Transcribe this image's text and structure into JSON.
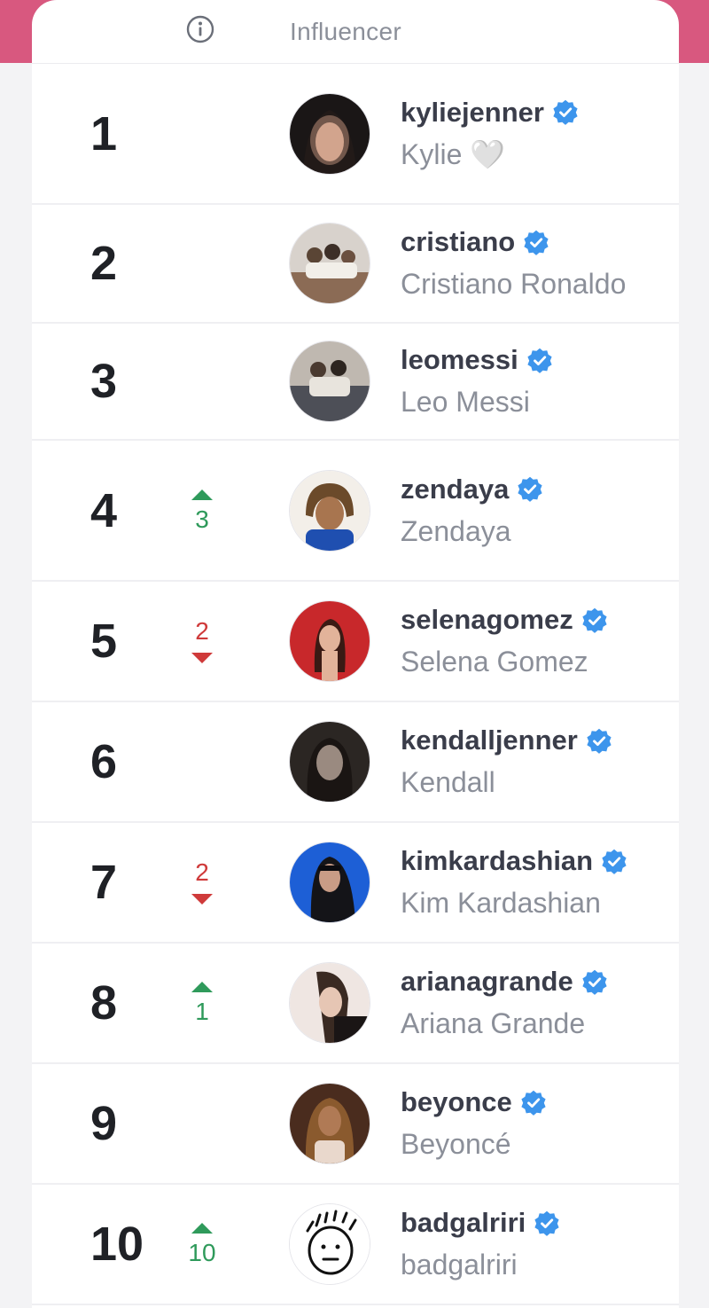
{
  "header": {
    "info_icon": "info-circle-icon",
    "column_label": "Influencer"
  },
  "colors": {
    "brand_pink": "#d8587f",
    "up_green": "#2f9a5b",
    "down_red": "#cf3a3a",
    "verified_blue": "#3d95ec"
  },
  "rows": [
    {
      "rank": "1",
      "username": "kyliejenner",
      "name": "Kylie 🤍",
      "change": {
        "dir": "none",
        "value": ""
      }
    },
    {
      "rank": "2",
      "username": "cristiano",
      "name": "Cristiano Ronaldo",
      "change": {
        "dir": "none",
        "value": ""
      }
    },
    {
      "rank": "3",
      "username": "leomessi",
      "name": "Leo Messi",
      "change": {
        "dir": "none",
        "value": ""
      }
    },
    {
      "rank": "4",
      "username": "zendaya",
      "name": "Zendaya",
      "change": {
        "dir": "up",
        "value": "3"
      }
    },
    {
      "rank": "5",
      "username": "selenagomez",
      "name": "Selena Gomez",
      "change": {
        "dir": "down",
        "value": "2"
      }
    },
    {
      "rank": "6",
      "username": "kendalljenner",
      "name": "Kendall",
      "change": {
        "dir": "none",
        "value": ""
      }
    },
    {
      "rank": "7",
      "username": "kimkardashian",
      "name": "Kim Kardashian",
      "change": {
        "dir": "down",
        "value": "2"
      }
    },
    {
      "rank": "8",
      "username": "arianagrande",
      "name": "Ariana Grande",
      "change": {
        "dir": "up",
        "value": "1"
      }
    },
    {
      "rank": "9",
      "username": "beyonce",
      "name": "Beyoncé",
      "change": {
        "dir": "none",
        "value": ""
      }
    },
    {
      "rank": "10",
      "username": "badgalriri",
      "name": "badgalriri",
      "change": {
        "dir": "up",
        "value": "10"
      }
    }
  ]
}
